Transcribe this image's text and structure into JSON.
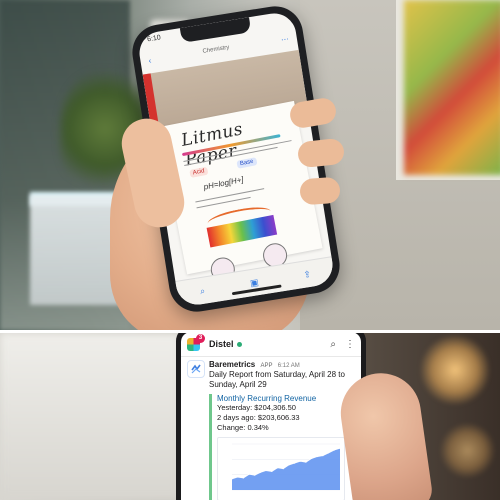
{
  "top_photo": {
    "phone": {
      "status_time": "6:10",
      "nav_center": "Chemistry",
      "note_title": "Litmus Paper",
      "chips": [
        "Acid",
        "Base"
      ],
      "ph_text": "pH=log[H+]",
      "icons": [
        "back-chevron-icon",
        "share-icon",
        "edit-icon",
        "more-icon",
        "search-icon",
        "camera-icon",
        "export-icon"
      ]
    }
  },
  "bottom_photo": {
    "slack": {
      "workspace": "Distel",
      "notification_count": "3",
      "message": {
        "sender": "Baremetrics",
        "app_tag": "APP",
        "time": "6:12 AM",
        "report_prefix": "Daily Report",
        "report_from": "from Saturday, April 28 to Sunday, April 29",
        "attachment": {
          "title": "Monthly Recurring Revenue",
          "yesterday_label": "Yesterday:",
          "yesterday_value": "$204,306.50",
          "two_days_label": "2 days ago:",
          "two_days_value": "$203,606.33",
          "change_label": "Change:",
          "change_value": "0.34%"
        }
      }
    }
  },
  "colors": {
    "slack_link": "#1264a3",
    "attachment_bar": "#6fc78c",
    "chart_fill": "#5b8ff0",
    "presence": "#2bac76"
  },
  "chart_data": {
    "type": "area",
    "title": "",
    "xlabel": "",
    "ylabel": "",
    "grid": true,
    "values": [
      12,
      14,
      13,
      17,
      16,
      19,
      21,
      20,
      24,
      23,
      27,
      29,
      31,
      30,
      34,
      36,
      37,
      40,
      43,
      45
    ]
  }
}
